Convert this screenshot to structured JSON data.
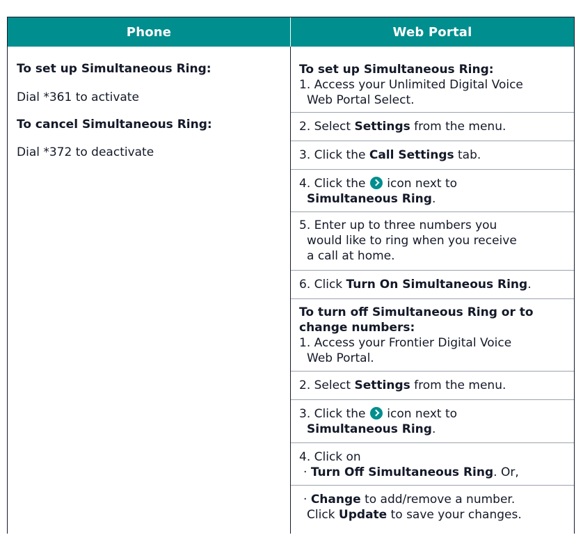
{
  "colors": {
    "header_bg": "#008E8E",
    "text": "#141928",
    "rule": "#9AA3AD",
    "icon": "#008E8E"
  },
  "header": {
    "phone": "Phone",
    "web_portal": "Web Portal"
  },
  "phone": {
    "setup_heading": "To set up Simultaneous Ring:",
    "setup_step": "Dial *361 to activate",
    "cancel_heading": "To cancel Simultaneous Ring:",
    "cancel_step": "Dial *372 to deactivate"
  },
  "web": {
    "setup_heading": "To set up Simultaneous Ring:",
    "s1a": "1. Access your Unlimited Digital Voice",
    "s1b": "Web Portal Select.",
    "s2a": "2. Select ",
    "s2b": "Settings",
    "s2c": " from the menu.",
    "s3a": "3. Click the ",
    "s3b": "Call Settings",
    "s3c": " tab.",
    "s4a": "4. Click the ",
    "s4b": " icon next to",
    "s4c": "Simultaneous Ring",
    "s4d": ".",
    "s5a": "5. Enter up to three numbers you",
    "s5b": "would like to ring when you receive",
    "s5c": "a call at home.",
    "s6a": "6. Click ",
    "s6b": "Turn On Simultaneous Ring",
    "s6c": ".",
    "off_heading_1": "To turn off Simultaneous Ring or to",
    "off_heading_2": "change numbers:",
    "o1a": "1. Access your Frontier Digital Voice",
    "o1b": "Web Portal.",
    "o2a": "2. Select ",
    "o2b": "Settings",
    "o2c": " from the menu.",
    "o3a": "3. Click the ",
    "o3b": " icon next to",
    "o3c": "Simultaneous Ring",
    "o3d": ".",
    "o4a": "4. Click on",
    "o4b_bullet": "· ",
    "o4b_bold": "Turn Off Simultaneous Ring",
    "o4b_rest": ". Or,",
    "o5_bullet": "· ",
    "o5_bold": "Change",
    "o5_rest": " to add/remove a number.",
    "o5b_a": "Click ",
    "o5b_bold": "Update",
    "o5b_rest": " to save your changes."
  }
}
